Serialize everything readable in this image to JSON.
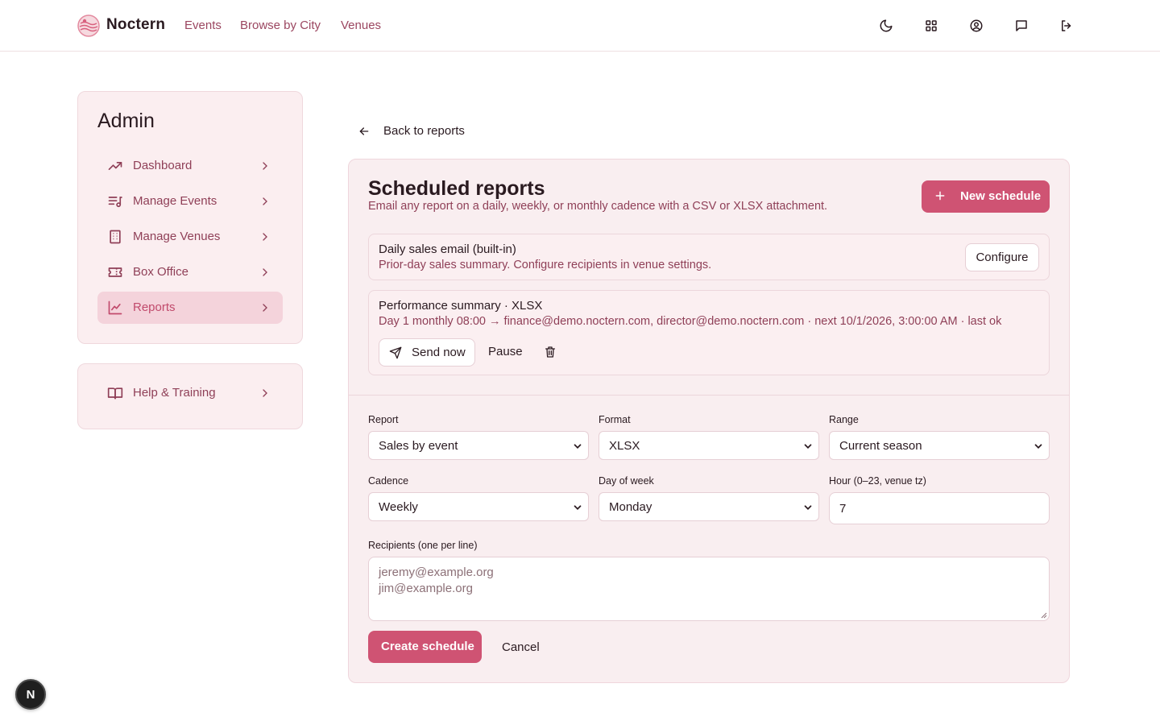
{
  "header": {
    "brand": "Noctern",
    "nav": {
      "events": "Events",
      "browse_by_city": "Browse by City",
      "venues": "Venues"
    },
    "icons": [
      "moon-icon",
      "dashboard-grid-icon",
      "account-circle-icon",
      "message-icon",
      "logout-icon"
    ]
  },
  "sidebar": {
    "title": "Admin",
    "items": [
      {
        "label": "Dashboard",
        "icon": "trend-up-icon"
      },
      {
        "label": "Manage Events",
        "icon": "music-list-icon"
      },
      {
        "label": "Manage Venues",
        "icon": "building-icon"
      },
      {
        "label": "Box Office",
        "icon": "ticket-icon"
      },
      {
        "label": "Reports",
        "icon": "line-chart-icon",
        "active": true
      }
    ],
    "help": {
      "label": "Help & Training",
      "icon": "book-icon"
    }
  },
  "back": {
    "label": "Back to reports"
  },
  "main": {
    "title": "Scheduled reports",
    "subtitle": "Email any report on a daily, weekly, or monthly cadence with a CSV or XLSX attachment.",
    "new_button": "New schedule",
    "builtin": {
      "title": "Daily sales email (built-in)",
      "desc": "Prior-day sales summary. Configure recipients in venue settings.",
      "configure": "Configure"
    },
    "schedule": {
      "title": "Performance summary · XLSX",
      "desc": "Day 1 monthly 08:00 → finance@demo.noctern.com, director@demo.noctern.com · next 10/1/2026, 3:00:00 AM · last ok",
      "send_now": "Send now",
      "pause": "Pause"
    },
    "form": {
      "report_label": "Report",
      "report_value": "Sales by event",
      "format_label": "Format",
      "format_value": "XLSX",
      "range_label": "Range",
      "range_value": "Current season",
      "cadence_label": "Cadence",
      "cadence_value": "Weekly",
      "dow_label": "Day of week",
      "dow_value": "Monday",
      "hour_label": "Hour (0–23, venue tz)",
      "hour_value": "7",
      "recipients_label": "Recipients (one per line)",
      "recipients": [
        "jeremy@example.org",
        "jim@example.org"
      ],
      "create": "Create schedule",
      "cancel": "Cancel"
    }
  },
  "dev_badge": "N",
  "colors": {
    "accent": "#cf5373",
    "link": "#9b4660",
    "card_bg": "#fbeef0",
    "active_bg": "#f4d3db"
  }
}
